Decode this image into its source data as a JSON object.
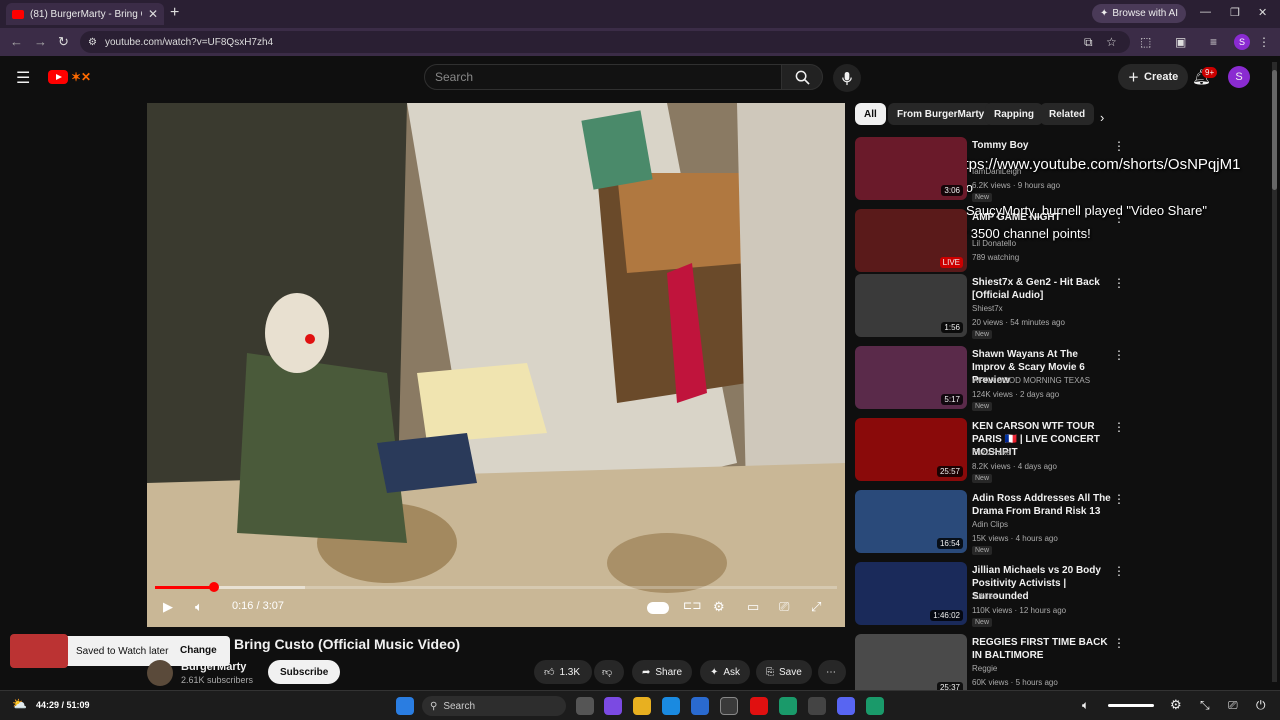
{
  "browser": {
    "tab_title": "(81) BurgerMarty - Bring Custo",
    "new_tab": "+",
    "browse_ai": "Browse with AI",
    "url": "youtube.com/watch?v=UF8QsxH7zh4",
    "profile_letter": "S"
  },
  "header": {
    "search_placeholder": "Search",
    "create_label": "Create",
    "notif_count": "9+",
    "avatar_letter": "S"
  },
  "player": {
    "time": "0:16 / 3:07",
    "progress": 0.086,
    "buffered": 0.22
  },
  "toast": {
    "text": "Saved to Watch later",
    "action": "Change"
  },
  "video": {
    "title": "Bring Custo (Official Music Video)",
    "channel": "BurgerMarty",
    "subscribers": "2.61K subscribers",
    "subscribe_label": "Subscribe",
    "likes": "1.3K",
    "share_label": "Share",
    "ask_label": "Ask",
    "save_label": "Save"
  },
  "chips": [
    "All",
    "From BurgerMarty",
    "Rapping",
    "Related"
  ],
  "recommendations": [
    {
      "title": "Tommy Boy",
      "channel": "IamDaniLeigh",
      "meta": "6.2K views · 9 hours ago",
      "badge": "New",
      "duration": "3:06",
      "thumb_color": "#6a1a2a"
    },
    {
      "title": "AMP GAME NIGHT",
      "channel": "Lil Donatello",
      "meta": "789 watching",
      "badge": "",
      "duration": "LIVE",
      "thumb_color": "#5a1a1a"
    },
    {
      "title": "Shiest7x & Gen2 - Hit Back [Official Audio]",
      "channel": "Shiest7x",
      "meta": "20 views · 54 minutes ago",
      "badge": "New",
      "duration": "1:56",
      "thumb_color": "#3a3a3a"
    },
    {
      "title": "Shawn Wayans At The Improv & Scary Movie 6 Preview",
      "channel": "WFAA GOOD MORNING TEXAS",
      "meta": "124K views · 2 days ago",
      "badge": "New",
      "duration": "5:17",
      "thumb_color": "#5a2a4a"
    },
    {
      "title": "KEN CARSON WTF TOUR PARIS 🇫🇷 | LIVE CONCERT MOSHPIT",
      "channel": "Enzo Paka",
      "meta": "8.2K views · 4 days ago",
      "badge": "New",
      "duration": "25:57",
      "thumb_color": "#8a0a0a"
    },
    {
      "title": "Adin Ross Addresses All The Drama From Brand Risk 13",
      "channel": "Adin Clips",
      "meta": "15K views · 4 hours ago",
      "badge": "New",
      "duration": "16:54",
      "thumb_color": "#2a4a7a"
    },
    {
      "title": "Jillian Michaels vs 20 Body Positivity Activists | Surrounded",
      "channel": "Jubilee",
      "meta": "110K views · 12 hours ago",
      "badge": "New",
      "duration": "1:46:02",
      "thumb_color": "#1a2a5a"
    },
    {
      "title": "REGGIES FIRST TIME BACK IN BALTIMORE",
      "channel": "Reggie",
      "meta": "60K views · 5 hours ago",
      "badge": "",
      "duration": "25:37",
      "thumb_color": "#4a4a4a"
    }
  ],
  "overlay": {
    "line1": "https://www.youtube.com/shorts/OsNPqjM1",
    "line2": "oco",
    "line3": "SaucyMorty_burnell played \"Video Share\"",
    "line4": "for 3500 channel points!"
  },
  "taskbar": {
    "time": "44:29 / 51:09",
    "search": "Search"
  },
  "icons": {
    "menu": "hamburger-icon",
    "search": "search-icon",
    "mic": "mic-icon",
    "bell": "bell-icon"
  }
}
